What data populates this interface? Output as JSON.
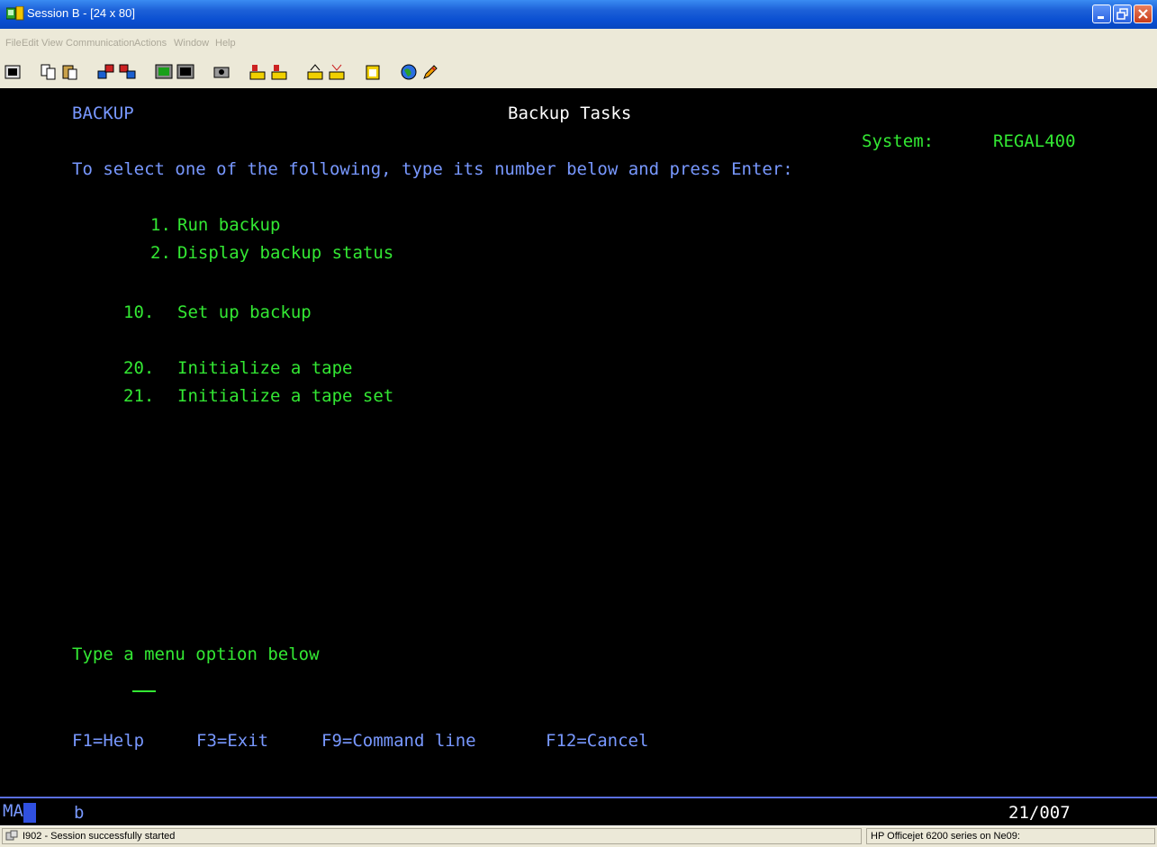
{
  "window": {
    "title": "Session B - [24 x 80]"
  },
  "menu": [
    "File",
    "Edit",
    "View",
    "Communication",
    "Actions",
    "Window",
    "Help"
  ],
  "toolbar_icons": [
    "print-screen-icon",
    "copy-icon",
    "paste-icon",
    "send-icon",
    "receive-icon",
    "display-icon",
    "keyboard-icon",
    "macro-icon",
    "record-icon",
    "play-icon",
    "transfer-icon",
    "transfer-icon-2",
    "clipboard-icon",
    "web-icon",
    "pencil-icon"
  ],
  "screen": {
    "menu_name": "BACKUP",
    "title": "Backup Tasks",
    "system_label": "System:",
    "system_name": "REGAL400",
    "instruction": "To select one of the following, type its number below and press Enter:",
    "options": [
      {
        "number": "1.",
        "label": "Run backup"
      },
      {
        "number": "2.",
        "label": "Display backup status"
      },
      {
        "number": "10.",
        "label": "Set up backup"
      },
      {
        "number": "20.",
        "label": "Initialize a tape"
      },
      {
        "number": "21.",
        "label": "Initialize a tape set"
      }
    ],
    "prompt": "Type a menu option below",
    "input_value": "",
    "function_keys": [
      "F1=Help",
      "F3=Exit",
      "F9=Command line",
      "F12=Cancel"
    ]
  },
  "oia": {
    "mode": "MA",
    "indicator": "b",
    "cursor_position": "21/007"
  },
  "statusbar": {
    "message": "I902 - Session successfully started",
    "printer": "HP Officejet 6200 series on Ne09:"
  },
  "colors": {
    "title_bar": "#0a4fd1",
    "terminal_bg": "#000000",
    "terminal_green": "#33e833",
    "terminal_blue": "#7898ff",
    "terminal_white": "#ffffff"
  }
}
